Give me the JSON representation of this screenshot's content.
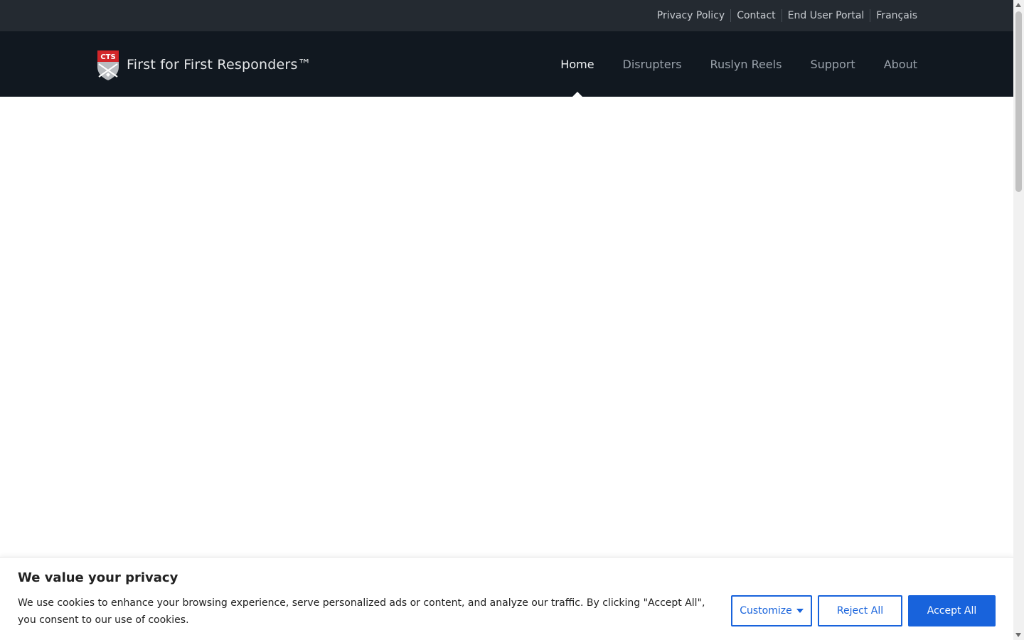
{
  "utility_nav": {
    "links": [
      "Privacy Policy",
      "Contact",
      "End User Portal",
      "Français"
    ]
  },
  "brand": {
    "logo_text": "CTS",
    "tagline": "First for First Responders™"
  },
  "main_nav": {
    "items": [
      "Home",
      "Disrupters",
      "Ruslyn Reels",
      "Support",
      "About"
    ],
    "active": "Home"
  },
  "cookie_banner": {
    "title": "We value your privacy",
    "text": "We use cookies to enhance your browsing experience, serve personalized ads or content, and analyze our traffic. By clicking \"Accept All\", you consent to our use of cookies.",
    "customize_label": "Customize",
    "reject_label": "Reject All",
    "accept_label": "Accept All"
  },
  "colors": {
    "utility_bar_bg": "#242a31",
    "nav_bg": "#111820",
    "accent_blue": "#1863dc",
    "logo_red": "#d3262a"
  },
  "icons": {
    "logo": "cts-shield-logo",
    "customize_caret": "caret-down-icon"
  }
}
